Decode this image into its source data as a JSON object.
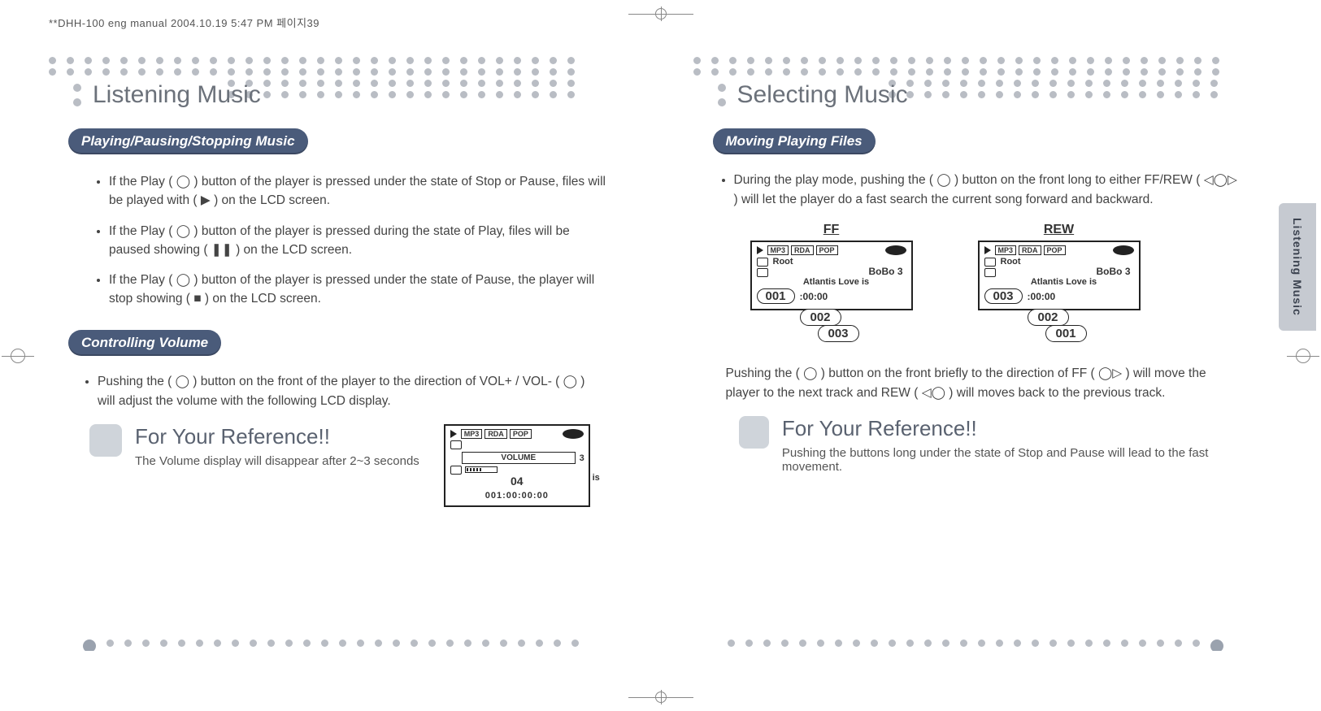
{
  "print_header": "**DHH-100 eng manual  2004.10.19 5:47 PM  페이지39",
  "side_tab": "Listening Music",
  "left_page": {
    "section_title": "Listening Music",
    "sub1": "Playing/Pausing/Stopping Music",
    "bullets1": [
      "If the Play ( ◯ ) button of the player is pressed under the state of Stop or Pause, files will be played with ( ▶ ) on the LCD screen.",
      "If the Play ( ◯ ) button of the player is pressed during the state of Play, files will be paused showing ( ❚❚ ) on the LCD screen.",
      "If the Play ( ◯ ) button of the player is pressed under the state of Pause, the player will stop showing ( ■ ) on the LCD screen."
    ],
    "sub2": "Controlling Volume",
    "vol_para": "Pushing the ( ◯ ) button on the front of the player to the direction of VOL+ / VOL- ( ◯ ) will adjust the volume with the following LCD display.",
    "ref_title": "For Your Reference!!",
    "ref_sub": "The Volume display will disappear after 2~3 seconds",
    "lcd_vol": {
      "tags": [
        "MP3",
        "RDA",
        "POP"
      ],
      "vol_label": "VOLUME",
      "vol_value": "04",
      "right_small_top": "3",
      "right_small_bot": "is",
      "time": "001:00:00:00"
    }
  },
  "right_page": {
    "section_title": "Selecting Music",
    "sub1": "Moving Playing Files",
    "para1": "During the play mode, pushing the ( ◯ ) button on the front long to either FF/REW ( ◁◯▷ ) will let the player do a fast search the current song forward and backward.",
    "ff": {
      "label": "FF",
      "root": "Root",
      "artist": "BoBo 3",
      "title": "Atlantis Love is",
      "track": "001",
      "time": ":00:00",
      "stack": [
        "002",
        "003"
      ]
    },
    "rew": {
      "label": "REW",
      "root": "Root",
      "artist": "BoBo 3",
      "title": "Atlantis Love is",
      "track": "003",
      "time": ":00:00",
      "stack": [
        "002",
        "001"
      ]
    },
    "para2": "Pushing the ( ◯ ) button on the front briefly to the direction of FF ( ◯▷ ) will move the player to the next track and REW ( ◁◯ ) will moves back to the previous track.",
    "ref_title": "For Your Reference!!",
    "ref_sub": "Pushing the buttons long under the state of Stop and Pause will lead to the fast movement."
  }
}
